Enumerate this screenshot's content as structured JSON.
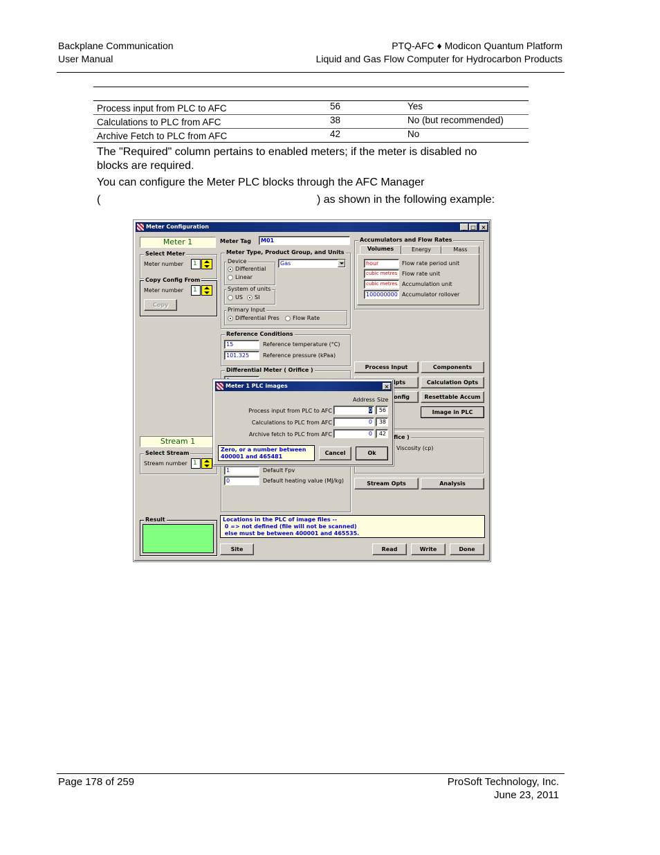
{
  "header": {
    "left_line1": "Backplane Communication",
    "left_line2": "User Manual",
    "right_line1": "PTQ-AFC ♦ Modicon Quantum Platform",
    "right_line2": "Liquid and Gas Flow Computer for Hydrocarbon Products"
  },
  "table": {
    "rows": [
      {
        "block": "Process input from PLC to AFC",
        "size": "56",
        "required": "Yes"
      },
      {
        "block": "Calculations to PLC from AFC",
        "size": "38",
        "required": "No (but recommended)"
      },
      {
        "block": "Archive Fetch to PLC from AFC",
        "size": "42",
        "required": "No"
      }
    ]
  },
  "body": {
    "para1_line1": "The \"Required\" column pertains to enabled meters; if the meter is disabled no",
    "para1_line2": "blocks are required.",
    "para2_line1": "You can configure the Meter PLC blocks through the AFC Manager",
    "para2_line2_open": "(",
    "para2_line2_close": ") as shown in the following example:"
  },
  "meter_config": {
    "title": "Meter Configuration",
    "title_buttons": {
      "minimize": "_",
      "maximize": "□",
      "close": "×"
    },
    "meter_label": "Meter 1",
    "select_meter": {
      "group": "Select Meter",
      "label": "Meter number",
      "value": "1"
    },
    "copy_config": {
      "group": "Copy Config From",
      "label": "Meter number",
      "value": "1",
      "button": "Copy"
    },
    "meter_tag": {
      "label": "Meter Tag",
      "value": "M01"
    },
    "meter_type": {
      "group": "Meter Type, Product Group, and Units",
      "device_group": "Device",
      "device_options": [
        {
          "label": "Differential",
          "selected": true
        },
        {
          "label": "Linear",
          "selected": false
        }
      ],
      "product_group": "Gas",
      "units_group": "System of units",
      "units_options": [
        {
          "label": "US",
          "selected": false
        },
        {
          "label": "SI",
          "selected": true
        }
      ],
      "primary_group": "Primary Input",
      "primary_options": [
        {
          "label": "Differential Pres",
          "selected": true
        },
        {
          "label": "Flow Rate",
          "selected": false
        }
      ]
    },
    "accumulators": {
      "group": "Accumulators and Flow Rates",
      "tabs": [
        "Volumes",
        "Energy",
        "Mass"
      ],
      "active_tab": "Volumes",
      "rows": [
        {
          "value": "hour",
          "label": "Flow rate period unit"
        },
        {
          "value": "cubic metres",
          "label": "Flow rate unit"
        },
        {
          "value": "cubic metres",
          "label": "Accumulation unit"
        },
        {
          "value": "100000000",
          "label": "Accumulator rollover"
        }
      ]
    },
    "reference_conditions": {
      "group": "Reference Conditions",
      "rows": [
        {
          "value": "15",
          "label": "Reference temperature (°C)"
        },
        {
          "value": "101.325",
          "label": "Reference pressure (kPaa)"
        }
      ]
    },
    "differential_meter": {
      "group": "Differential Meter ( Orifice )",
      "partial_value": "0"
    },
    "stream_fields": [
      {
        "value": "1",
        "label": "Default Fpv"
      },
      {
        "value": "0",
        "label": "Default heating value (MJ/kg)"
      }
    ],
    "right_meter_group": {
      "group": "Meter ( Orifice )",
      "label": "Viscosity (cp)"
    },
    "buttons": {
      "process_input": "Process Input",
      "components": "Components",
      "meter_opts_partial": "lpts",
      "calculation_opts": "Calculation Opts",
      "config_partial": "onfig",
      "resettable_accum": "Resettable Accum",
      "image_in_plc": "Image in PLC",
      "stream_opts": "Stream Opts",
      "analysis": "Analysis",
      "site": "Site",
      "read": "Read",
      "write": "Write",
      "done": "Done"
    },
    "stream_label": "Stream 1",
    "select_stream": {
      "group": "Select Stream",
      "label": "Stream number",
      "value": "1"
    },
    "result": {
      "group": "Result",
      "color": "#80ff80"
    },
    "info_lines": [
      "Locations in the PLC of image files --",
      " 0 => not defined (file will not be scanned)",
      " else must be between 400001 and 465535."
    ]
  },
  "plc_dialog": {
    "title": "Meter 1 PLC images",
    "close": "×",
    "col_address": "Address",
    "col_size": "Size",
    "rows": [
      {
        "label": "Process input from PLC to AFC",
        "address": "0",
        "size": "56"
      },
      {
        "label": "Calculations to PLC from AFC",
        "address": "0",
        "size": "38"
      },
      {
        "label": "Archive fetch to PLC from AFC",
        "address": "0",
        "size": "42"
      }
    ],
    "hint_line1": "Zero, or a number between",
    "hint_line2": "400001 and 465481",
    "cancel": "Cancel",
    "ok": "Ok"
  },
  "footer": {
    "page": "Page 178 of 259",
    "company": "ProSoft Technology, Inc.",
    "date": "June 23, 2011"
  }
}
